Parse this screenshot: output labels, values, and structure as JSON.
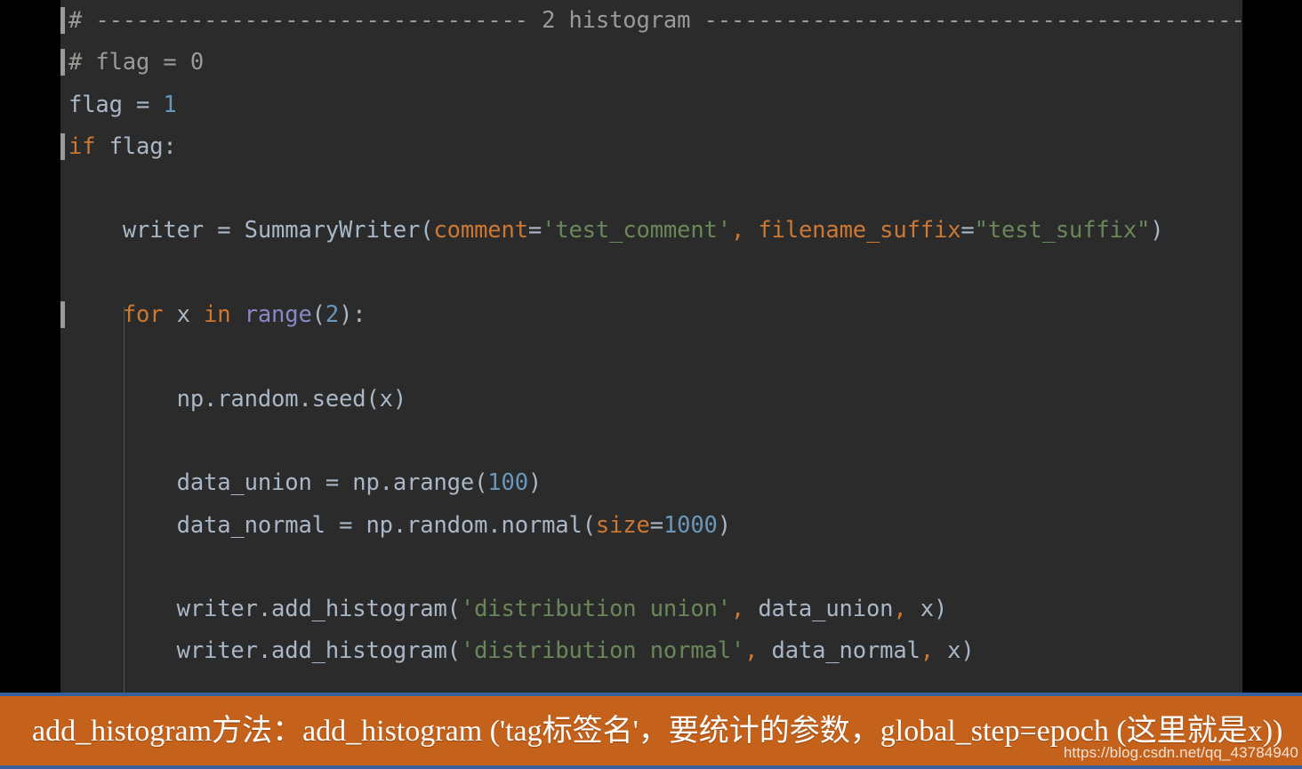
{
  "editor": {
    "theme_background": "#2b2b2b",
    "outer_background": "#000000",
    "lines": [
      {
        "id": "line-comment-header",
        "indent": 0,
        "gutter_mark": true,
        "tokens": [
          {
            "cls": "c-comment",
            "t": "# -------------------------------- 2 histogram -----------------------------------------"
          }
        ]
      },
      {
        "id": "line-comment-flag-zero",
        "indent": 0,
        "gutter_mark": true,
        "tokens": [
          {
            "cls": "c-comment",
            "t": "# flag = 0"
          }
        ]
      },
      {
        "id": "line-flag-assign",
        "indent": 0,
        "gutter_mark": false,
        "tokens": [
          {
            "cls": "c-ident",
            "t": "flag "
          },
          {
            "cls": "c-punct",
            "t": "= "
          },
          {
            "cls": "c-number",
            "t": "1"
          }
        ]
      },
      {
        "id": "line-if-flag",
        "indent": 0,
        "gutter_mark": true,
        "tokens": [
          {
            "cls": "c-keyword",
            "t": "if"
          },
          {
            "cls": "c-ident",
            "t": " flag"
          },
          {
            "cls": "c-punct",
            "t": ":"
          }
        ]
      },
      {
        "id": "line-blank-1",
        "indent": 0,
        "gutter_mark": false,
        "tokens": [
          {
            "cls": "c-ident",
            "t": ""
          }
        ]
      },
      {
        "id": "line-writer-summarywriter",
        "indent": 1,
        "gutter_mark": false,
        "tokens": [
          {
            "cls": "c-ident",
            "t": "writer "
          },
          {
            "cls": "c-punct",
            "t": "= "
          },
          {
            "cls": "c-func",
            "t": "SummaryWriter"
          },
          {
            "cls": "c-paren",
            "t": "("
          },
          {
            "cls": "c-kwarg",
            "t": "comment"
          },
          {
            "cls": "c-punct",
            "t": "="
          },
          {
            "cls": "c-string",
            "t": "'test_comment'"
          },
          {
            "cls": "c-comma",
            "t": ", "
          },
          {
            "cls": "c-kwarg",
            "t": "filename_suffix"
          },
          {
            "cls": "c-punct",
            "t": "="
          },
          {
            "cls": "c-string",
            "t": "\"test_suffix\""
          },
          {
            "cls": "c-paren",
            "t": ")"
          }
        ]
      },
      {
        "id": "line-blank-2",
        "indent": 0,
        "gutter_mark": false,
        "tokens": [
          {
            "cls": "c-ident",
            "t": ""
          }
        ]
      },
      {
        "id": "line-for-range",
        "indent": 1,
        "gutter_mark": true,
        "tokens": [
          {
            "cls": "c-keyword",
            "t": "for"
          },
          {
            "cls": "c-ident",
            "t": " x "
          },
          {
            "cls": "c-keyword",
            "t": "in"
          },
          {
            "cls": "c-ident",
            "t": " "
          },
          {
            "cls": "c-builtin",
            "t": "range"
          },
          {
            "cls": "c-paren",
            "t": "("
          },
          {
            "cls": "c-number",
            "t": "2"
          },
          {
            "cls": "c-paren",
            "t": ")"
          },
          {
            "cls": "c-punct",
            "t": ":"
          }
        ]
      },
      {
        "id": "line-blank-3",
        "indent": 0,
        "gutter_mark": false,
        "tokens": [
          {
            "cls": "c-ident",
            "t": ""
          }
        ]
      },
      {
        "id": "line-np-seed",
        "indent": 2,
        "gutter_mark": false,
        "tokens": [
          {
            "cls": "c-ident",
            "t": "np.random.seed"
          },
          {
            "cls": "c-paren",
            "t": "("
          },
          {
            "cls": "c-ident",
            "t": "x"
          },
          {
            "cls": "c-paren",
            "t": ")"
          }
        ]
      },
      {
        "id": "line-blank-4",
        "indent": 0,
        "gutter_mark": false,
        "tokens": [
          {
            "cls": "c-ident",
            "t": ""
          }
        ]
      },
      {
        "id": "line-data-union",
        "indent": 2,
        "gutter_mark": false,
        "tokens": [
          {
            "cls": "c-ident",
            "t": "data_union "
          },
          {
            "cls": "c-punct",
            "t": "= "
          },
          {
            "cls": "c-ident",
            "t": "np.arange"
          },
          {
            "cls": "c-paren",
            "t": "("
          },
          {
            "cls": "c-number",
            "t": "100"
          },
          {
            "cls": "c-paren",
            "t": ")"
          }
        ]
      },
      {
        "id": "line-data-normal",
        "indent": 2,
        "gutter_mark": false,
        "tokens": [
          {
            "cls": "c-ident",
            "t": "data_normal "
          },
          {
            "cls": "c-punct",
            "t": "= "
          },
          {
            "cls": "c-ident",
            "t": "np.random.normal"
          },
          {
            "cls": "c-paren",
            "t": "("
          },
          {
            "cls": "c-kwarg",
            "t": "size"
          },
          {
            "cls": "c-punct",
            "t": "="
          },
          {
            "cls": "c-number",
            "t": "1000"
          },
          {
            "cls": "c-paren",
            "t": ")"
          }
        ]
      },
      {
        "id": "line-blank-5",
        "indent": 0,
        "gutter_mark": false,
        "tokens": [
          {
            "cls": "c-ident",
            "t": ""
          }
        ]
      },
      {
        "id": "line-add-histogram-union",
        "indent": 2,
        "gutter_mark": false,
        "tokens": [
          {
            "cls": "c-ident",
            "t": "writer.add_histogram"
          },
          {
            "cls": "c-paren",
            "t": "("
          },
          {
            "cls": "c-string",
            "t": "'distribution union'"
          },
          {
            "cls": "c-comma",
            "t": ", "
          },
          {
            "cls": "c-ident",
            "t": "data_union"
          },
          {
            "cls": "c-comma",
            "t": ", "
          },
          {
            "cls": "c-ident",
            "t": "x"
          },
          {
            "cls": "c-paren",
            "t": ")"
          }
        ]
      },
      {
        "id": "line-add-histogram-normal",
        "indent": 2,
        "gutter_mark": false,
        "tokens": [
          {
            "cls": "c-ident",
            "t": "writer.add_histogram"
          },
          {
            "cls": "c-paren",
            "t": "("
          },
          {
            "cls": "c-string",
            "t": "'distribution normal'"
          },
          {
            "cls": "c-comma",
            "t": ", "
          },
          {
            "cls": "c-ident",
            "t": "data_normal"
          },
          {
            "cls": "c-comma",
            "t": ", "
          },
          {
            "cls": "c-ident",
            "t": "x"
          },
          {
            "cls": "c-paren",
            "t": ")"
          }
        ]
      }
    ]
  },
  "caption": {
    "text": "add_histogram方法：add_histogram ('tag标签名'，要统计的参数，global_step=epoch (这里就是x))",
    "background_color": "#c4611b",
    "border_color": "#3a5f9e",
    "text_color": "#ffffff"
  },
  "watermark": {
    "text": "https://blog.csdn.net/qq_43784940"
  }
}
